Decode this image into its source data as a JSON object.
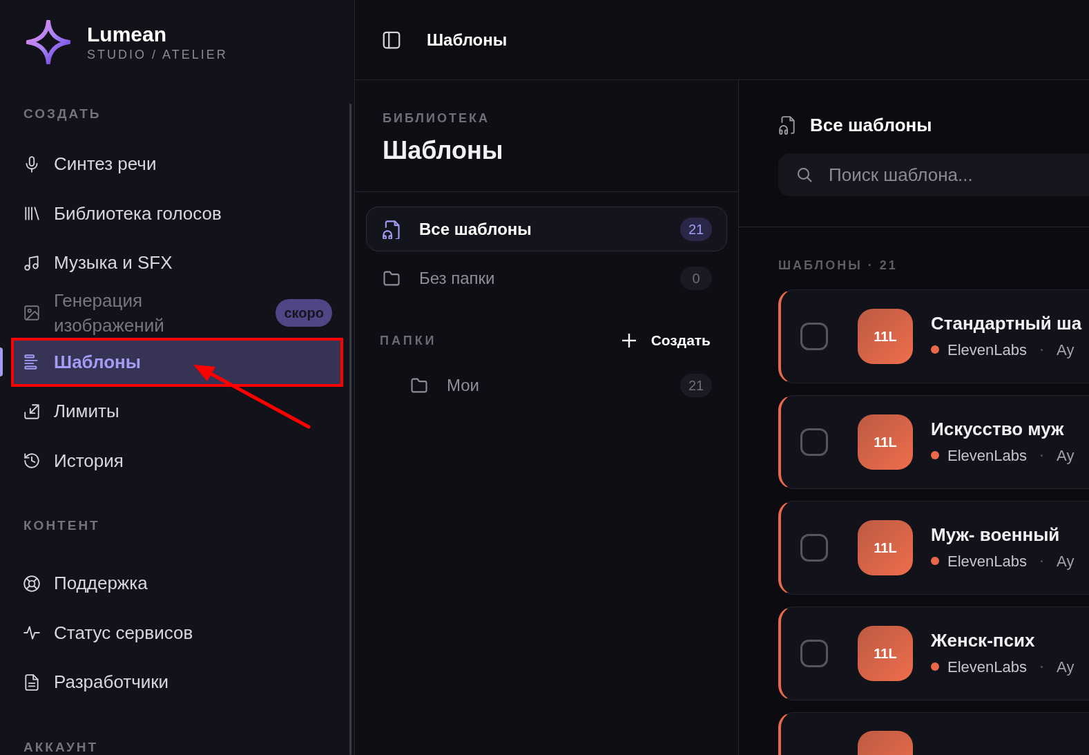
{
  "brand": {
    "name": "Lumean",
    "tagline": "STUDIO / ATELIER"
  },
  "sidebar": {
    "sections": [
      {
        "title": "СОЗДАТЬ",
        "items": [
          {
            "label": "Синтез речи",
            "selected": false,
            "disabled": false,
            "highlighted": false
          },
          {
            "label": "Библиотека голосов",
            "selected": false,
            "disabled": false,
            "highlighted": false
          },
          {
            "label": "Музыка и SFX",
            "selected": false,
            "disabled": false,
            "highlighted": false
          },
          {
            "label": "Генерация изображений",
            "selected": false,
            "disabled": true,
            "highlighted": false,
            "badge": "скоро"
          },
          {
            "label": "Шаблоны",
            "selected": true,
            "disabled": false,
            "highlighted": true
          },
          {
            "label": "Лимиты",
            "selected": false,
            "disabled": false,
            "highlighted": false
          },
          {
            "label": "История",
            "selected": false,
            "disabled": false,
            "highlighted": false
          }
        ]
      },
      {
        "title": "КОНТЕНТ",
        "items": [
          {
            "label": "Поддержка",
            "selected": false,
            "disabled": false,
            "highlighted": false
          },
          {
            "label": "Статус сервисов",
            "selected": false,
            "disabled": false,
            "highlighted": false
          },
          {
            "label": "Разработчики",
            "selected": false,
            "disabled": false,
            "highlighted": false
          }
        ]
      },
      {
        "title": "АККАУНТ"
      }
    ]
  },
  "topbar": {
    "title": "Шаблоны"
  },
  "library": {
    "eyebrow": "БИБЛИОТЕКА",
    "title": "Шаблоны",
    "filters": [
      {
        "label": "Все шаблоны",
        "count": "21",
        "selected": true
      },
      {
        "label": "Без папки",
        "count": "0",
        "selected": false
      }
    ],
    "folders_header": "ПАПКИ",
    "create_button": "Создать",
    "folders": [
      {
        "label": "Мои",
        "count": "21",
        "selected": false
      }
    ]
  },
  "content": {
    "title": "Все шаблоны",
    "search": {
      "placeholder": "Поиск шаблона..."
    },
    "list_header": "ШАБЛОНЫ · 21",
    "templates": [
      {
        "kind": "full",
        "badge": "11L",
        "title": "Стандартный ша",
        "provider": "ElevenLabs",
        "category": "Ау",
        "checked": false
      },
      {
        "kind": "full",
        "badge": "11L",
        "title": "Искусство муж",
        "provider": "ElevenLabs",
        "category": "Ау",
        "checked": false
      },
      {
        "kind": "full",
        "badge": "11L",
        "title": "Муж- военный",
        "provider": "ElevenLabs",
        "category": "Ау",
        "checked": false
      },
      {
        "kind": "full",
        "badge": "11L",
        "title": "Женск-псих",
        "provider": "ElevenLabs",
        "category": "Ау",
        "checked": false
      },
      {
        "kind": "cut"
      }
    ]
  }
}
